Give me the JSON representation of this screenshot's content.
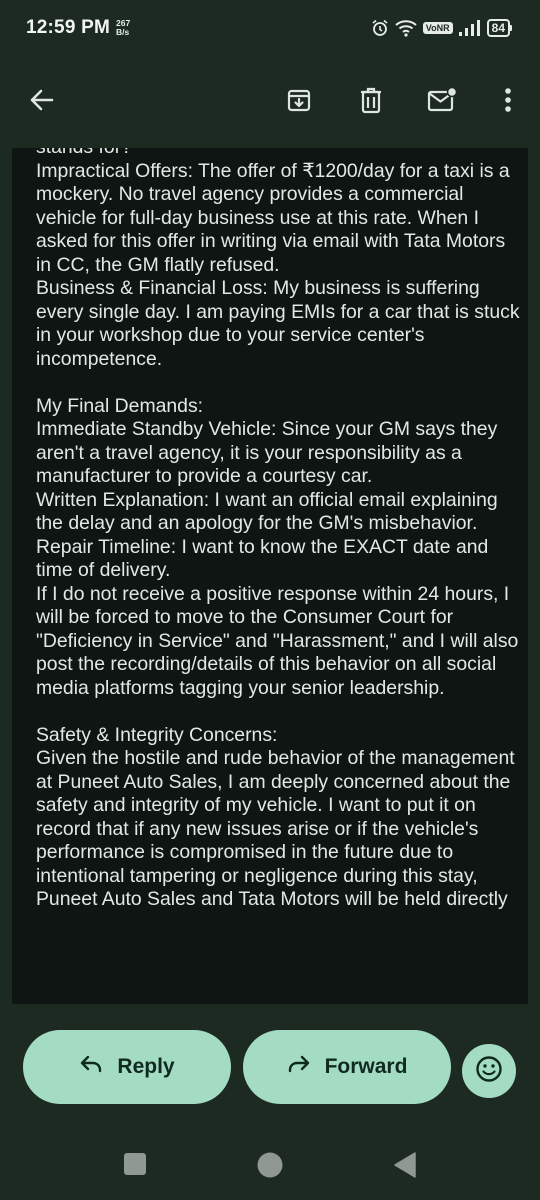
{
  "status_bar": {
    "time": "12:59 PM",
    "net_speed_value": "267",
    "net_speed_unit": "B/s",
    "volte": "VoNR",
    "battery": "84"
  },
  "toolbar": {
    "icons": [
      "back-arrow-icon",
      "archive-icon",
      "delete-icon",
      "mark-unread-icon",
      "more-vert-icon"
    ]
  },
  "message": {
    "lines": [
      "stands for?",
      "Impractical Offers: The offer of ₹1200/day for a taxi is a mockery. No travel agency provides a commercial vehicle for full-day business use at this rate. When I asked for this offer in writing via email with Tata Motors in CC, the GM flatly refused.",
      "Business & Financial Loss: My business is suffering every single day. I am paying EMIs for a car that is stuck in your workshop due to your service center's incompetence.",
      "",
      "My Final Demands:",
      "Immediate Standby Vehicle: Since your GM says they aren't a travel agency, it is your responsibility as a manufacturer to provide a courtesy car.",
      "Written Explanation: I want an official email explaining the delay and an apology for the GM's misbehavior.",
      "Repair Timeline: I want to know the EXACT date and time of delivery.",
      "If I do not receive a positive response within 24 hours, I will be forced to move to the Consumer Court for \"Deficiency in Service\" and \"Harassment,\" and I will also post the recording/details of this behavior on all social media platforms tagging your senior leadership.",
      "",
      "Safety & Integrity Concerns:",
      "Given the hostile and rude behavior of the management at Puneet Auto Sales, I am deeply concerned about the safety and integrity of my vehicle. I want to put it on record that if any new issues arise or if the vehicle's performance is compromised in the future due to intentional tampering or negligence during this stay, Puneet Auto Sales and Tata Motors will be held directly"
    ]
  },
  "actions": {
    "reply_label": "Reply",
    "forward_label": "Forward"
  },
  "colors": {
    "background": "#1c2a22",
    "message_background": "#0f1512",
    "pill": "#a4dcc3",
    "pill_text": "#0f2a1e"
  }
}
